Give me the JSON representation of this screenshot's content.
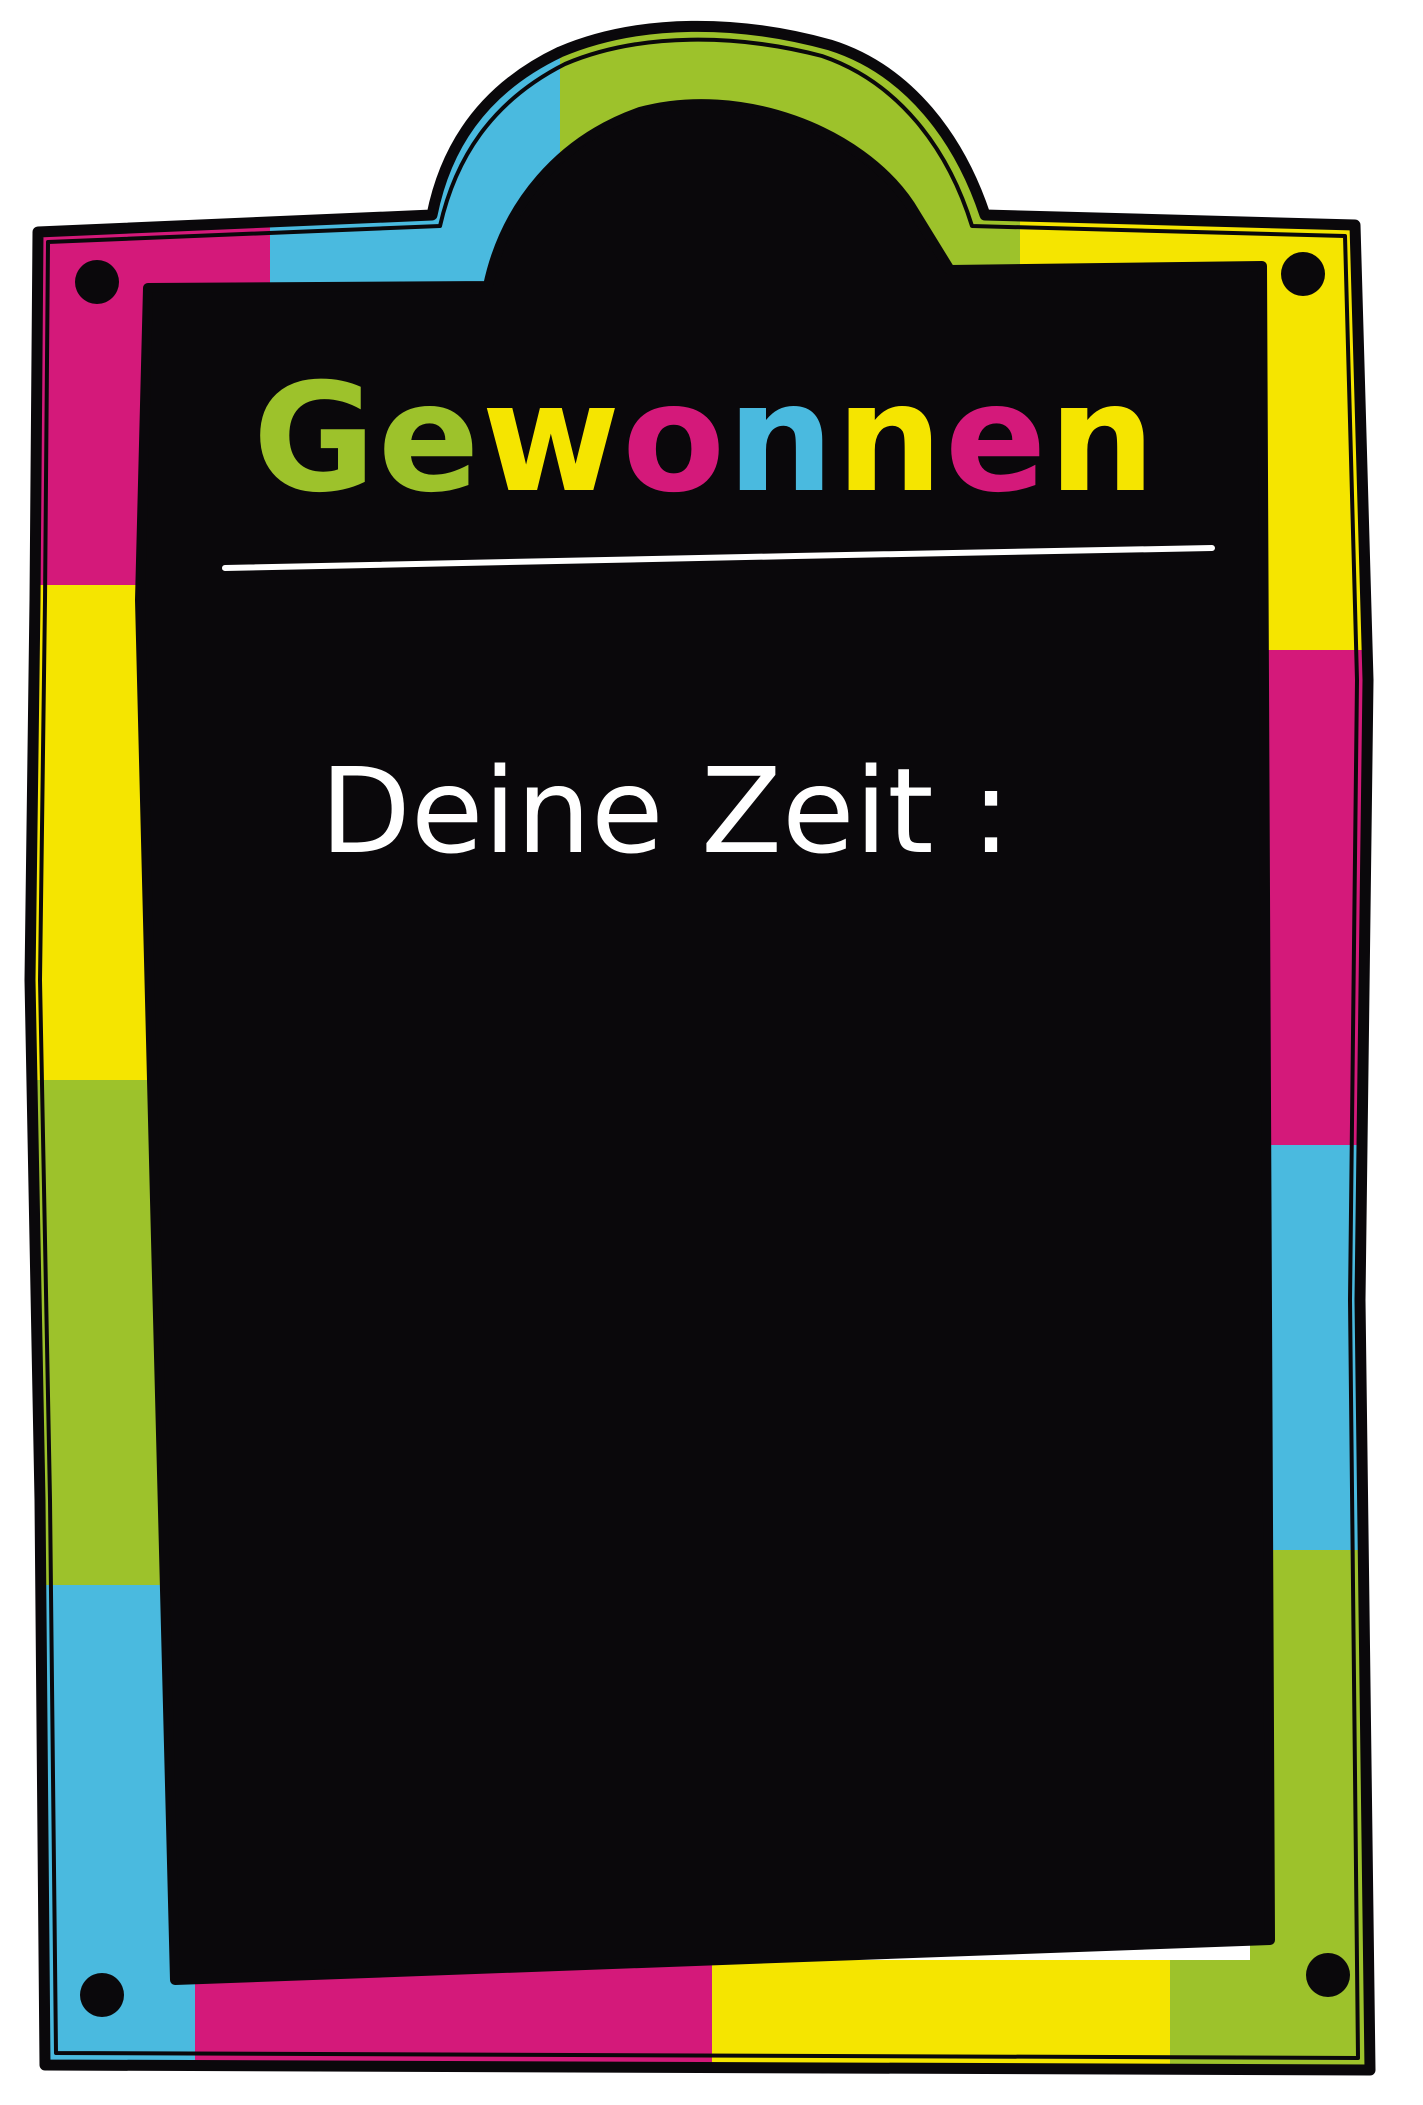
{
  "title": {
    "text": "Gewonnen",
    "letters": [
      {
        "char": "G",
        "color": "#9DC22B"
      },
      {
        "char": "e",
        "color": "#9DC22B"
      },
      {
        "char": "w",
        "color": "#F5E500"
      },
      {
        "char": "o",
        "color": "#D4197A"
      },
      {
        "char": "n",
        "color": "#4ABADF"
      },
      {
        "char": "n",
        "color": "#F5E500"
      },
      {
        "char": "e",
        "color": "#D4197A"
      },
      {
        "char": "n",
        "color": "#F5E500"
      }
    ]
  },
  "time_label": "Deine Zeit :",
  "colors": {
    "board": "#0A080B",
    "chalk": "#FFFFFF",
    "green": "#9DC22B",
    "blue": "#4ABADF",
    "pink": "#D4197A",
    "yellow": "#F5E500",
    "outline": "#0A080B"
  }
}
